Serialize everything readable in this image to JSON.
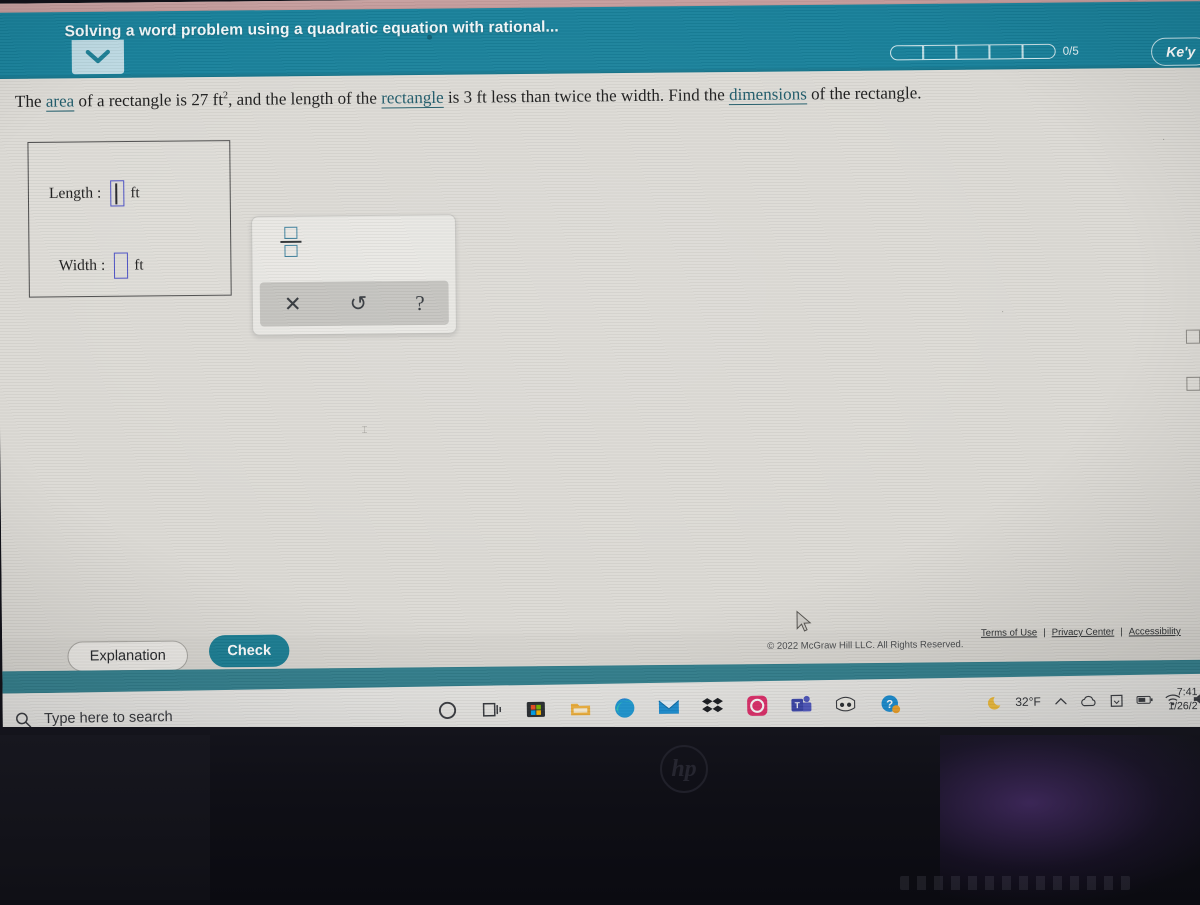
{
  "browser": {
    "bookmarks_hint": "⊕ ⊡ ⊞"
  },
  "app_header": {
    "title": "Solving a word problem using a quadratic equation with rational...",
    "progress": {
      "segments": 5,
      "filled": 0,
      "label": "0/5"
    },
    "account_label": "Ke'y",
    "collapse_icon": "chevron-down-icon"
  },
  "problem": {
    "intro": "The ",
    "link_area": "area",
    "mid1": " of a rectangle is 27 ft",
    "exponent": "2",
    "mid2": ", and the length of the ",
    "link_rectangle": "rectangle",
    "mid3": " is 3 ft less than twice the width. Find the ",
    "link_dimensions": "dimensions",
    "tail": " of the rectangle."
  },
  "answer_card": {
    "length_label": "Length :",
    "length_value": "",
    "length_unit": "ft",
    "width_label": "Width :",
    "width_value": "",
    "width_unit": "ft"
  },
  "palette": {
    "fraction_icon": "fraction-icon",
    "clear_label": "✕",
    "undo_label": "↺",
    "help_label": "?"
  },
  "footer": {
    "explanation_label": "Explanation",
    "check_label": "Check",
    "copyright": "© 2022 McGraw Hill LLC. All Rights Reserved.",
    "terms_label": "Terms of Use",
    "privacy_label": "Privacy Center",
    "accessibility_label": "Accessibility",
    "separator": "|"
  },
  "taskbar": {
    "search_placeholder": "Type here to search",
    "search_icon": "search-icon",
    "items": [
      {
        "name": "cortana-icon",
        "label": "Cortana"
      },
      {
        "name": "task-view-icon",
        "label": "Task View"
      },
      {
        "name": "microsoft-store-icon",
        "label": "Microsoft Store"
      },
      {
        "name": "file-explorer-icon",
        "label": "File Explorer"
      },
      {
        "name": "microsoft-edge-icon",
        "label": "Microsoft Edge"
      },
      {
        "name": "mail-icon",
        "label": "Mail"
      },
      {
        "name": "dropbox-icon",
        "label": "Dropbox"
      },
      {
        "name": "instagram-icon",
        "label": "Instagram"
      },
      {
        "name": "microsoft-teams-icon",
        "label": "Microsoft Teams"
      },
      {
        "name": "app-icon",
        "label": "App"
      },
      {
        "name": "help-icon",
        "label": "Get Help"
      }
    ],
    "tray": {
      "weather_temp": "32°F",
      "weather_icon": "moon-icon",
      "overflow_icon": "chevron-up-icon",
      "cloud_icon": "cloud-icon",
      "onedrive_icon": "onedrive-icon",
      "battery_icon": "battery-icon",
      "network_icon": "wifi-icon",
      "volume_icon": "speaker-muted-icon",
      "time": "7:41",
      "date": "1/26/2"
    }
  },
  "device": {
    "brand_logo": "hp"
  },
  "colors": {
    "teal_header": "#17809a",
    "teal_footer_bar": "#34818f",
    "check_button": "#1b7e94",
    "page_bg": "#dcdad5",
    "math_field_border": "#4a4fc4",
    "link": "#1d5a69"
  }
}
